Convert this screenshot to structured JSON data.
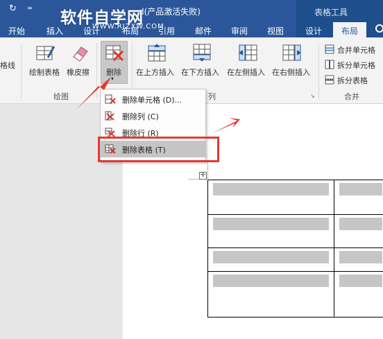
{
  "title_bar": {
    "autosave_icon": "refresh-icon",
    "menu_icon": "dropdown-icon",
    "document_title": "d(产品激活失败)",
    "context_group_title": "表格工具"
  },
  "watermark": {
    "main": "软件自学网",
    "sub": "WWW.RJZXW.COM"
  },
  "tabs": [
    "开始",
    "插入",
    "设计",
    "布局",
    "引用",
    "邮件",
    "审阅",
    "视图",
    "设计",
    "布局"
  ],
  "active_tab": "布局",
  "ribbon": {
    "left_cut_label": "格线",
    "draw_group": {
      "label": "绘图",
      "buttons": [
        {
          "label": "绘制表格",
          "icon": "draw-table-icon"
        },
        {
          "label": "橡皮擦",
          "icon": "eraser-icon"
        }
      ]
    },
    "delete_button": {
      "label": "删除",
      "icon": "delete-table-icon"
    },
    "rows_cols_group": {
      "label": "列",
      "buttons": [
        {
          "label": "在上方插入",
          "icon": "insert-above-icon"
        },
        {
          "label": "在下方插入",
          "icon": "insert-below-icon"
        },
        {
          "label": "在左侧插入",
          "icon": "insert-left-icon"
        },
        {
          "label": "在右侧插入",
          "icon": "insert-right-icon"
        }
      ]
    },
    "merge_group": {
      "label": "合并",
      "buttons": [
        {
          "label": "合并单元格",
          "icon": "merge-cells-icon"
        },
        {
          "label": "拆分单元格",
          "icon": "split-cells-icon"
        },
        {
          "label": "拆分表格",
          "icon": "split-table-icon"
        }
      ]
    }
  },
  "delete_menu": {
    "items": [
      {
        "label": "删除单元格 (D)...",
        "icon": "delete-cells-icon"
      },
      {
        "label": "删除列 (C)",
        "icon": "delete-columns-icon"
      },
      {
        "label": "删除行 (R)",
        "icon": "delete-rows-icon"
      },
      {
        "label": "删除表格 (T)",
        "icon": "delete-table-icon",
        "highlighted": true
      }
    ]
  },
  "colors": {
    "title_bar": "#2b579a",
    "context_tab": "#1e4e8c",
    "annotation_red": "#e53935",
    "cell_shading": "#c6c6c6"
  }
}
